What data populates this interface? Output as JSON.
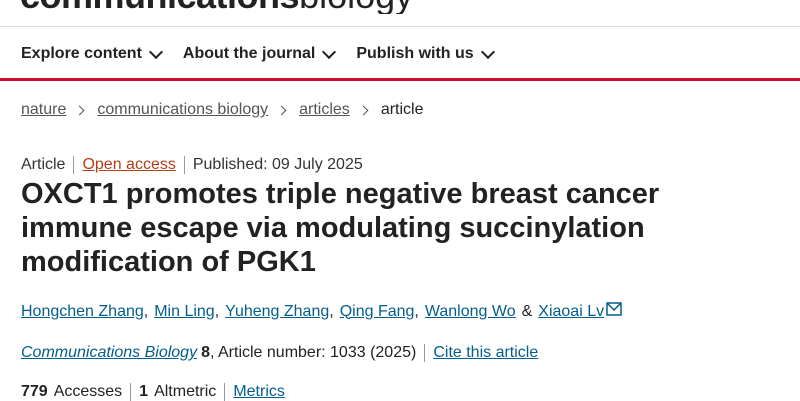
{
  "brand": {
    "name_bold": "communications",
    "name_light": "biology"
  },
  "nav": [
    {
      "label": "Explore content"
    },
    {
      "label": "About the journal"
    },
    {
      "label": "Publish with us"
    }
  ],
  "breadcrumb": [
    "nature",
    "communications biology",
    "articles",
    "article"
  ],
  "article_meta": {
    "type": "Article",
    "access": "Open access",
    "published": "Published: 09 July 2025"
  },
  "title": "OXCT1 promotes triple negative breast cancer immune escape via modulating succinylation modification of PGK1",
  "authors": [
    "Hongchen Zhang",
    "Min Ling",
    "Yuheng Zhang",
    "Qing Fang",
    "Wanlong Wo",
    "Xiaoai Lv"
  ],
  "authors_sep": ",",
  "authors_amp": "&",
  "citation": {
    "journal": "Communications Biology",
    "volume": "8",
    "article_number_text": ", Article number: 1033 (2025)",
    "cite_label": "Cite this article"
  },
  "metrics": {
    "accesses_count": "779",
    "accesses_label": "Accesses",
    "altmetric_count": "1",
    "altmetric_label": "Altmetric",
    "metrics_label": "Metrics"
  },
  "colors": {
    "accent_red": "#c8102e",
    "link_blue": "#025e8d",
    "open_access_orange": "#b1401a"
  }
}
